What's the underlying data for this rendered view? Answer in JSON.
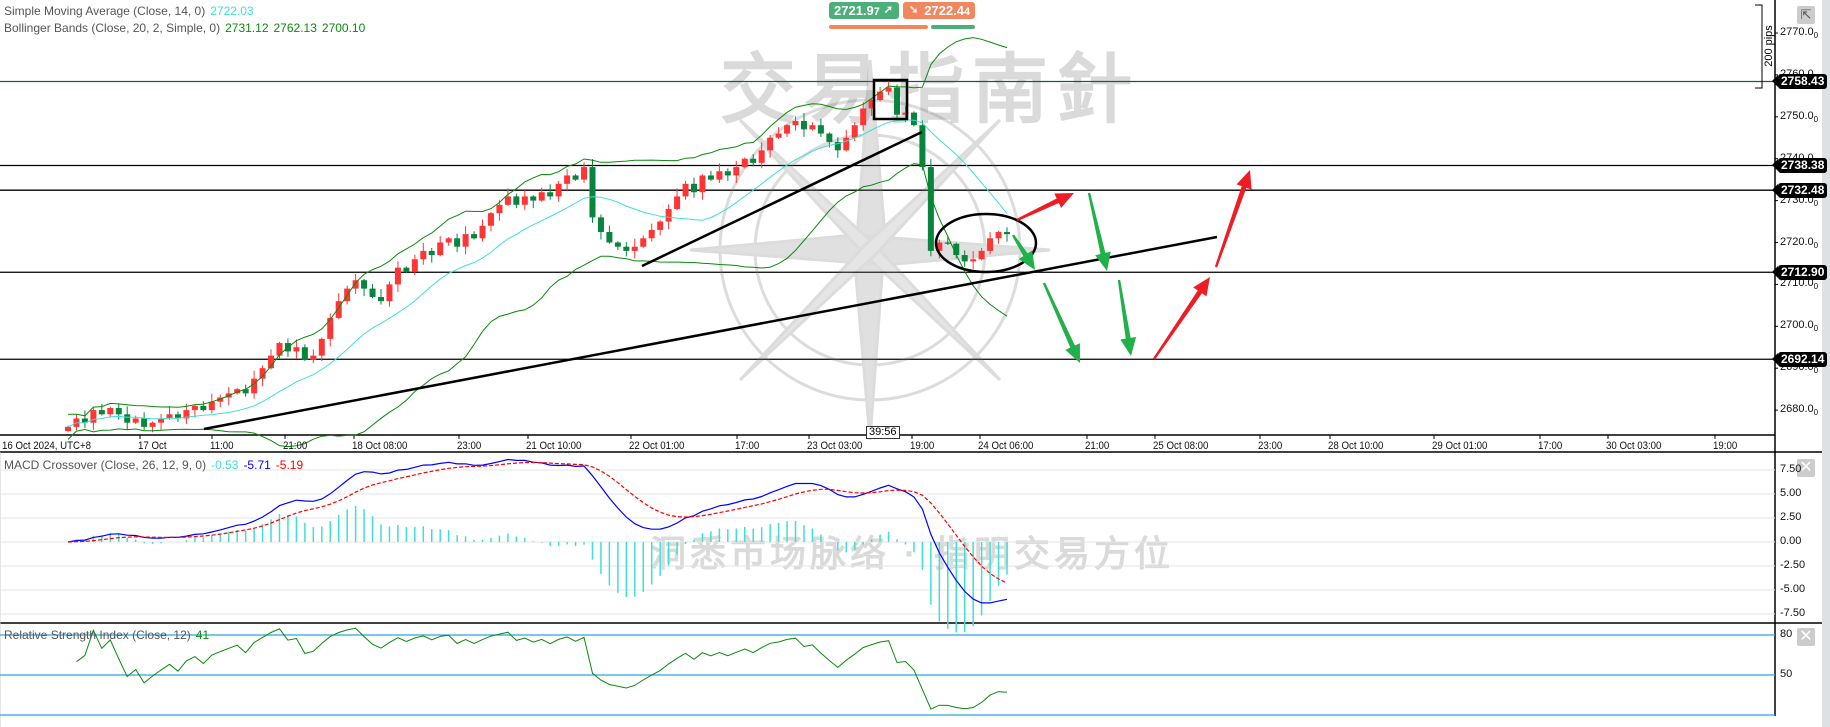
{
  "legends": {
    "sma": {
      "label": "Simple Moving Average (Close, 14, 0)",
      "value": "2722.03"
    },
    "bb": {
      "label": "Bollinger Bands (Close, 20, 2, Simple, 0)",
      "mid": "2731.12",
      "upper": "2762.13",
      "lower": "2700.10"
    },
    "macd": {
      "label": "MACD Crossover (Close, 26, 12, 9, 0)",
      "hist": "-0.53",
      "macd": "-5.71",
      "signal": "-5.19"
    },
    "rsi": {
      "label": "Relative Strength Index (Close, 12)",
      "value": "41"
    }
  },
  "quote": {
    "bid": "2721.9",
    "bid_sub": "7",
    "ask": "2722.4",
    "ask_sub": "4",
    "bid_icon": "arrow-up-right-icon",
    "ask_icon": "arrow-down-right-icon",
    "sentiment_sell_pct": 70,
    "sentiment_buy_pct": 30
  },
  "colors": {
    "up": "#ff3535",
    "down": "#08843e",
    "sma": "#40e0d0",
    "bb": "#0a8a0a",
    "macd": "#0000ff",
    "signal": "#ff0000",
    "hist": "#40e0d0",
    "rsi": "#0a8a0a",
    "rsi_levels": "#29a8e0",
    "bid": "#4caf7a",
    "ask": "#f2875f"
  },
  "countdown": "39:56",
  "pips_ruler": "200 pips",
  "watermark": {
    "title": "交易指南針",
    "slogan": "洞悉市场脉络 · 指明交易方位"
  },
  "chart_data": [
    {
      "type": "candlestick",
      "title": "",
      "ylim": [
        2674,
        2775
      ],
      "yticks": [
        "2770.0",
        "2760.0",
        "2750.0",
        "2740.0",
        "2730.0",
        "2720.0",
        "2710.0",
        "2700.0",
        "2690.0",
        "2680.0"
      ],
      "ytick_sub": "0",
      "xticks": [
        "16 Oct 2024, UTC+8",
        "17 Oct",
        "11:00",
        "21:00",
        "18 Oct 08:00",
        "23:00",
        "21 Oct 10:00",
        "22 Oct 01:00",
        "17:00",
        "23 Oct 03:00",
        "19:00",
        "24 Oct 06:00",
        "21:00",
        "25 Oct 08:00",
        "23:00",
        "28 Oct 10:00",
        "29 Oct 01:00",
        "17:00",
        "30 Oct 03:00",
        "19:00"
      ],
      "up_color": "red",
      "down_color": "green",
      "closes": [
        2676,
        2678,
        2677,
        2680,
        2679,
        2680.5,
        2679,
        2677,
        2678,
        2676,
        2677,
        2678,
        2679,
        2678,
        2680,
        2681,
        2680,
        2682,
        2683,
        2684,
        2685,
        2684,
        2687.5,
        2690,
        2693,
        2696,
        2694,
        2695,
        2692,
        2693,
        2697,
        2702,
        2706,
        2709,
        2711,
        2709,
        2707,
        2706,
        2710,
        2714,
        2713,
        2716,
        2718,
        2717,
        2720,
        2721,
        2719,
        2722,
        2721,
        2724,
        2727,
        2729,
        2731,
        2729,
        2731,
        2730,
        2732,
        2731,
        2734,
        2736,
        2735,
        2738,
        2726,
        2722.5,
        2720,
        2719,
        2718,
        2719,
        2721,
        2723,
        2725,
        2728,
        2731,
        2734,
        2732,
        2736,
        2735,
        2737,
        2736,
        2738,
        2740,
        2739,
        2742,
        2745,
        2746,
        2748,
        2749,
        2747,
        2748,
        2746,
        2744,
        2742,
        2745,
        2748,
        2752,
        2754,
        2756,
        2757,
        2750.5,
        2751,
        2748,
        2738,
        2718,
        2720,
        2719.7,
        2717,
        2715.5,
        2716,
        2718,
        2721,
        2722.5,
        2722
      ],
      "horizontal_levels": [
        "2758.43",
        "2738.38",
        "2732.48",
        "2712.90",
        "2692.14"
      ],
      "indicators": [
        "SMA 14",
        "Bollinger Bands 20,2"
      ],
      "annotations": [
        "ascending trendline (long)",
        "ascending trendline (short)",
        "box at top",
        "ellipse around consolidation",
        "red up arrows",
        "green down arrows"
      ]
    },
    {
      "type": "line",
      "title": "MACD Crossover (Close, 26, 12, 9, 0)",
      "yticks": [
        "7.50",
        "5.00",
        "2.50",
        "0.00",
        "-2.50",
        "-5.00",
        "-7.50"
      ],
      "ylim": [
        -8.5,
        9.5
      ],
      "series": [
        "MACD",
        "Signal",
        "Histogram"
      ]
    },
    {
      "type": "line",
      "title": "Relative Strength Index (Close, 12)",
      "yticks": [
        "80",
        "50"
      ],
      "levels": [
        80,
        50,
        20
      ],
      "ylim": [
        15,
        90
      ]
    }
  ]
}
